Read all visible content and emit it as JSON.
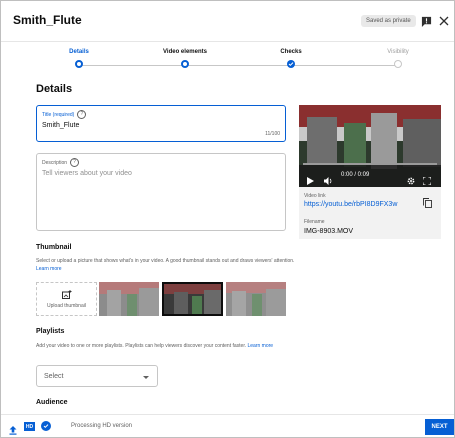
{
  "header": {
    "title": "Smith_Flute",
    "saved_badge": "Saved as private"
  },
  "steps": [
    {
      "label": "Details",
      "state": "current"
    },
    {
      "label": "Video elements",
      "state": "done"
    },
    {
      "label": "Checks",
      "state": "checked"
    },
    {
      "label": "Visibility",
      "state": "pending"
    }
  ],
  "details": {
    "heading": "Details",
    "title_field": {
      "label": "Title (required)",
      "value": "Smith_Flute",
      "counter": "11/100"
    },
    "description_field": {
      "label": "Description",
      "placeholder": "Tell viewers about your video"
    }
  },
  "thumbnail": {
    "title": "Thumbnail",
    "text": "Select or upload a picture that shows what's in your video. A good thumbnail stands out and draws viewers' attention.",
    "link": "Learn more",
    "upload_label": "Upload thumbnail"
  },
  "playlists": {
    "title": "Playlists",
    "text": "Add your video to one or more playlists. Playlists can help viewers discover your content faster.",
    "link": "Learn more",
    "select_value": "Select"
  },
  "audience": {
    "title": "Audience"
  },
  "video": {
    "time": "0:00 / 0:09",
    "progress": 0,
    "link_label": "Video link",
    "link": "https://youtu.be/rbPI8D9FX3w",
    "filename_label": "Filename",
    "filename": "IMG-8903.MOV"
  },
  "footer": {
    "status": "Processing HD version",
    "next_label": "NEXT",
    "hd_badge": "HD"
  },
  "colors": {
    "accent": "#065fd4",
    "check_blue": "#065fd4",
    "border": "#c6c6c6"
  }
}
